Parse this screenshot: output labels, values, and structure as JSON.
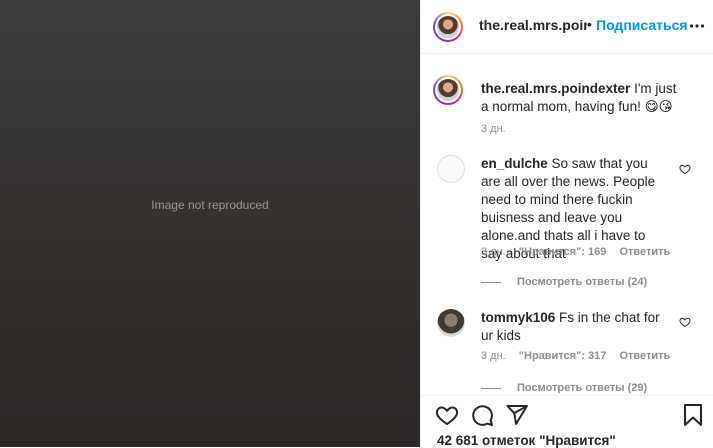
{
  "post": {
    "photo_alt": "Image not reproduced"
  },
  "header": {
    "username": "the.real.mrs.poindexter",
    "separator": "•",
    "follow_label": "Подписаться"
  },
  "caption": {
    "username": "the.real.mrs.poindexter",
    "text": " I'm just a normal mom, having fun! 😋😘",
    "time": "3 дн."
  },
  "comments": [
    {
      "username": "en_dulche",
      "text": " So saw that you are all over the news. People need to mind there fuckin buisness and leave you alone.and thats all i have to say about that",
      "time": "3 дн.",
      "likes": "\"Нравится\": 169",
      "reply_label": "Ответить",
      "replies": "Посмотреть ответы (24)"
    },
    {
      "username": "tommyk106",
      "text": " Fs in the chat for ur kids",
      "time": "3 дн.",
      "likes": "\"Нравится\": 317",
      "reply_label": "Ответить",
      "replies": "Посмотреть ответы (29)"
    }
  ],
  "footer": {
    "likes_count": "42 681 отметок \"Нравится\""
  },
  "icons": {
    "more": "more-horizontal-icon",
    "like": "heart-icon",
    "comment": "comment-bubble-icon",
    "share": "paper-plane-icon",
    "save": "bookmark-icon"
  },
  "colors": {
    "link_blue": "#0095f6",
    "text": "#262626",
    "muted": "#8e8e8e",
    "border": "#efefef"
  }
}
